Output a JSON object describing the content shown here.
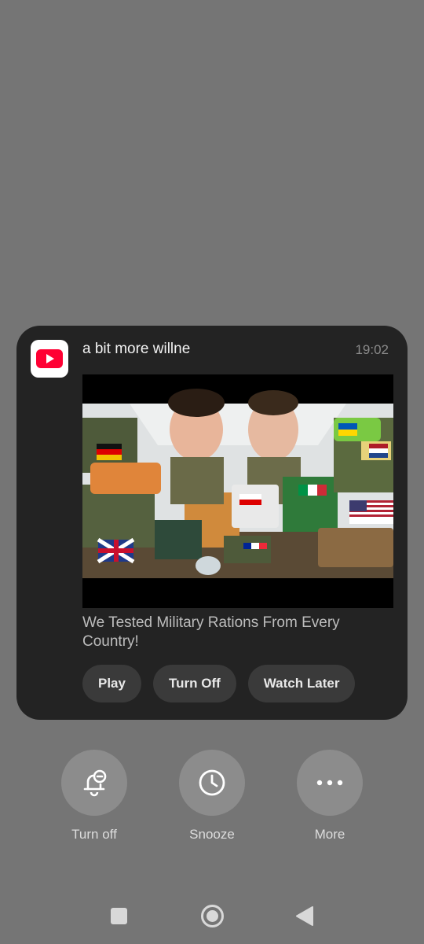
{
  "notification": {
    "app_icon": "youtube-icon",
    "title": "a bit more willne",
    "time": "19:02",
    "thumbnail_icon": "video-thumbnail",
    "body": "We Tested Military Rations From Every Country!",
    "actions": [
      {
        "label": "Play"
      },
      {
        "label": "Turn Off"
      },
      {
        "label": "Watch Later"
      }
    ]
  },
  "quick_actions": [
    {
      "label": "Turn off",
      "icon": "bell-minus-icon"
    },
    {
      "label": "Snooze",
      "icon": "clock-icon"
    },
    {
      "label": "More",
      "icon": "more-dots-icon"
    }
  ],
  "navbar": {
    "recents_icon": "square-icon",
    "home_icon": "circle-icon",
    "back_icon": "triangle-back-icon"
  },
  "colors": {
    "background": "#757575",
    "card": "#232323",
    "button": "#3a3a3a",
    "youtube_red": "#ff0033"
  }
}
